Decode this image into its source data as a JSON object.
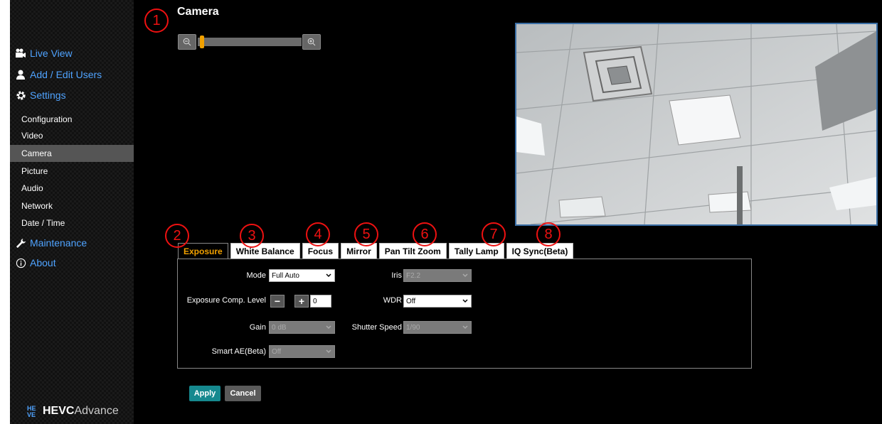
{
  "page": {
    "title": "Camera"
  },
  "sidebar": {
    "main_items": [
      {
        "label": "Live View",
        "icon": "camera-icon"
      },
      {
        "label": "Add / Edit Users",
        "icon": "user-icon"
      },
      {
        "label": "Settings",
        "icon": "gear-icon"
      },
      {
        "label": "Maintenance",
        "icon": "wrench-icon"
      },
      {
        "label": "About",
        "icon": "info-icon"
      }
    ],
    "settings_items": [
      "Configuration",
      "Video",
      "Camera",
      "Picture",
      "Audio",
      "Network",
      "Date / Time"
    ],
    "active_item": "Camera"
  },
  "brand": {
    "mark": "HE\nVE",
    "name_bold": "HEVC",
    "name_light": "Advance"
  },
  "zoom": {
    "zoom_out_icon": "zoom-out-icon",
    "zoom_in_icon": "zoom-in-icon",
    "level": 0.02
  },
  "callouts": [
    "1",
    "2",
    "3",
    "4",
    "5",
    "6",
    "7",
    "8"
  ],
  "tabs": [
    {
      "label": "Exposure",
      "active": true
    },
    {
      "label": "White Balance",
      "active": false
    },
    {
      "label": "Focus",
      "active": false
    },
    {
      "label": "Mirror",
      "active": false
    },
    {
      "label": "Pan Tilt Zoom",
      "active": false
    },
    {
      "label": "Tally Lamp",
      "active": false
    },
    {
      "label": "IQ Sync(Beta)",
      "active": false
    }
  ],
  "exposure": {
    "mode": {
      "label": "Mode",
      "value": "Full Auto"
    },
    "comp": {
      "label": "Exposure Comp. Level",
      "minus": "−",
      "plus": "+",
      "value": "0"
    },
    "gain": {
      "label": "Gain",
      "value": "0 dB"
    },
    "smart_ae": {
      "label": "Smart AE(Beta)",
      "value": "Off"
    },
    "iris": {
      "label": "Iris",
      "value": "F2.2"
    },
    "wdr": {
      "label": "WDR",
      "value": "Off"
    },
    "shutter": {
      "label": "Shutter Speed",
      "value": "1/90"
    }
  },
  "actions": {
    "apply": "Apply",
    "cancel": "Cancel"
  },
  "colors": {
    "accent": "#f0a000",
    "link": "#4fa3ff",
    "apply": "#16898f",
    "callout": "#e11111"
  }
}
